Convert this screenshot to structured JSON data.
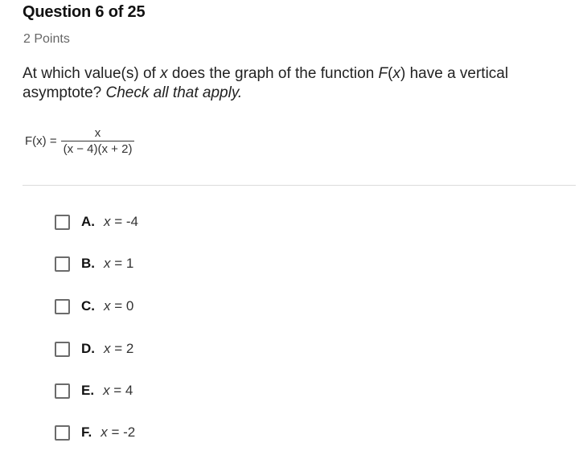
{
  "header": {
    "title": "Question 6 of 25",
    "points": "2 Points"
  },
  "question": {
    "text_part1": "At which value(s) of ",
    "var_x": "x",
    "text_part2": " does the graph of the function ",
    "func_name": "F",
    "func_open": "(",
    "func_var": "x",
    "func_close": ")",
    "text_part3": " have a vertical asymptote? ",
    "instruction": "Check all that apply."
  },
  "formula": {
    "lhs": "F(x) =",
    "numerator": "x",
    "denominator": "(x − 4)(x + 2)"
  },
  "options": [
    {
      "letter": "A.",
      "var": "x",
      "value": " = -4",
      "checked": false
    },
    {
      "letter": "B.",
      "var": "x",
      "value": " = 1",
      "checked": false
    },
    {
      "letter": "C.",
      "var": "x",
      "value": " = 0",
      "checked": false
    },
    {
      "letter": "D.",
      "var": "x",
      "value": " = 2",
      "checked": false
    },
    {
      "letter": "E.",
      "var": "x",
      "value": " = 4",
      "checked": false
    },
    {
      "letter": "F.",
      "var": "x",
      "value": " = -2",
      "checked": false
    }
  ]
}
